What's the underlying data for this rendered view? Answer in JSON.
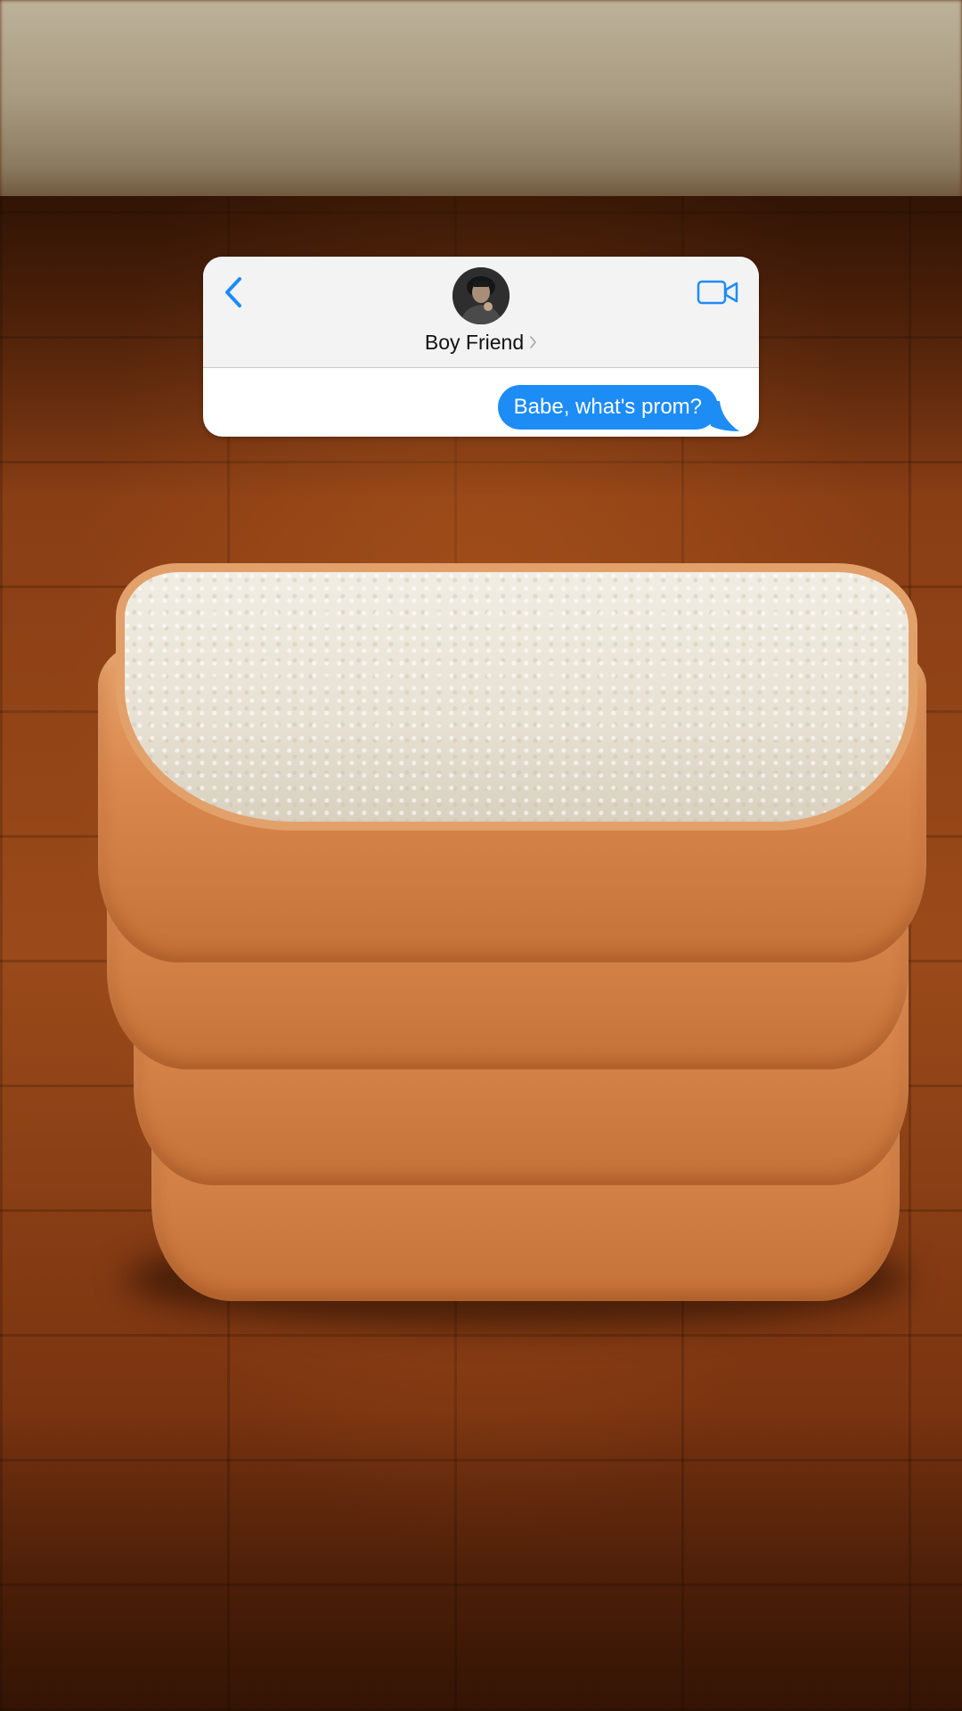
{
  "conversation": {
    "contact_name": "Boy Friend",
    "messages": [
      {
        "sender": "me",
        "text": "Babe, what's prom?"
      }
    ]
  },
  "icons": {
    "back": "chevron-left-icon",
    "video": "video-camera-icon",
    "contact_chevron": "chevron-right-icon"
  },
  "colors": {
    "accent": "#1d8cf5",
    "header_bg": "#f3f3f4",
    "bubble_text": "#ffffff"
  }
}
